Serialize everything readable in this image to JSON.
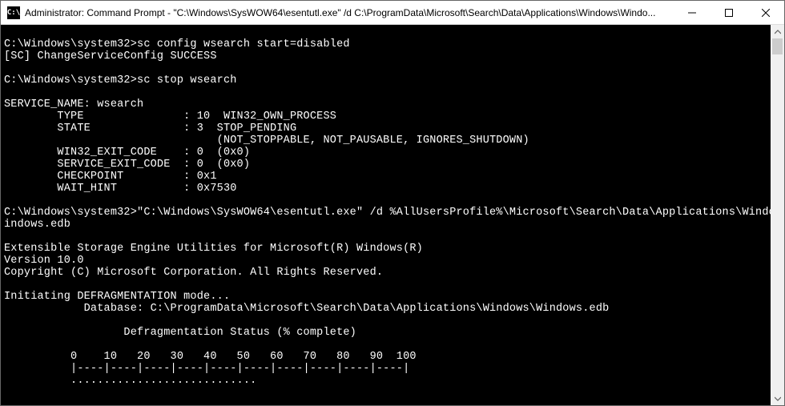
{
  "titlebar": {
    "icon_label": "C:\\",
    "title": "Administrator: Command Prompt - \"C:\\Windows\\SysWOW64\\esentutl.exe\"  /d C:\\ProgramData\\Microsoft\\Search\\Data\\Applications\\Windows\\Windo..."
  },
  "terminal": {
    "lines": [
      "",
      "C:\\Windows\\system32>sc config wsearch start=disabled",
      "[SC] ChangeServiceConfig SUCCESS",
      "",
      "C:\\Windows\\system32>sc stop wsearch",
      "",
      "SERVICE_NAME: wsearch",
      "        TYPE               : 10  WIN32_OWN_PROCESS",
      "        STATE              : 3  STOP_PENDING",
      "                                (NOT_STOPPABLE, NOT_PAUSABLE, IGNORES_SHUTDOWN)",
      "        WIN32_EXIT_CODE    : 0  (0x0)",
      "        SERVICE_EXIT_CODE  : 0  (0x0)",
      "        CHECKPOINT         : 0x1",
      "        WAIT_HINT          : 0x7530",
      "",
      "C:\\Windows\\system32>\"C:\\Windows\\SysWOW64\\esentutl.exe\" /d %AllUsersProfile%\\Microsoft\\Search\\Data\\Applications\\Windows\\W",
      "indows.edb",
      "",
      "Extensible Storage Engine Utilities for Microsoft(R) Windows(R)",
      "Version 10.0",
      "Copyright (C) Microsoft Corporation. All Rights Reserved.",
      "",
      "Initiating DEFRAGMENTATION mode...",
      "            Database: C:\\ProgramData\\Microsoft\\Search\\Data\\Applications\\Windows\\Windows.edb",
      "",
      "                  Defragmentation Status (% complete)",
      "",
      "          0    10   20   30   40   50   60   70   80   90  100",
      "          |----|----|----|----|----|----|----|----|----|----|",
      "          ............................"
    ]
  }
}
